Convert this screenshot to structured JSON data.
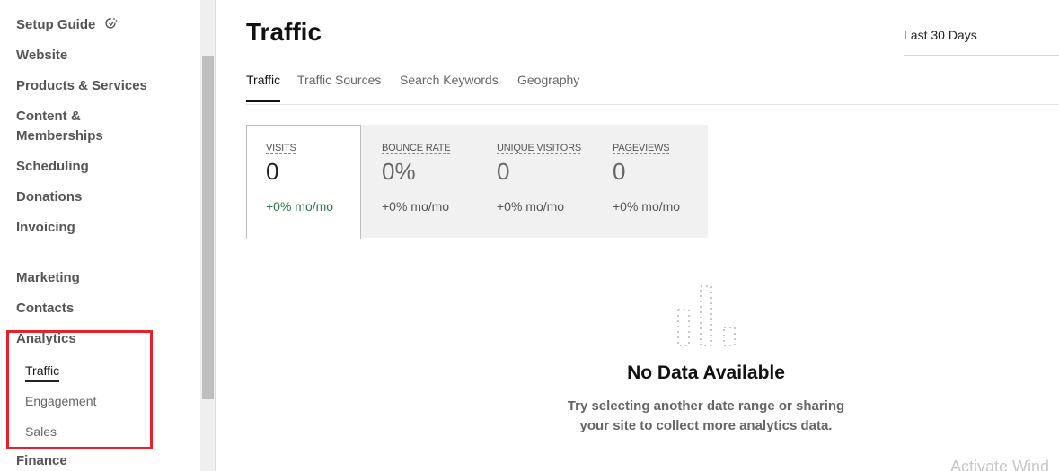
{
  "sidebar": {
    "items": [
      {
        "label": "Setup Guide",
        "icon": "setup-guide-check-icon"
      },
      {
        "label": "Website"
      },
      {
        "label": "Products & Services"
      },
      {
        "label": "Content &"
      },
      {
        "label": "Memberships"
      },
      {
        "label": "Scheduling"
      },
      {
        "label": "Donations"
      },
      {
        "label": "Invoicing"
      },
      {
        "label": "Marketing"
      },
      {
        "label": "Contacts"
      },
      {
        "label": "Analytics"
      },
      {
        "label": "Finance"
      }
    ],
    "analytics_sub": [
      {
        "label": "Traffic",
        "active": true
      },
      {
        "label": "Engagement"
      },
      {
        "label": "Sales"
      }
    ]
  },
  "header": {
    "title": "Traffic",
    "date_range": "Last 30 Days"
  },
  "tabs": [
    {
      "label": "Traffic",
      "active": true
    },
    {
      "label": "Traffic Sources"
    },
    {
      "label": "Search Keywords"
    },
    {
      "label": "Geography"
    }
  ],
  "metrics": [
    {
      "label": "VISITS",
      "value": "0",
      "change": "+0% mo/mo",
      "active": true
    },
    {
      "label": "BOUNCE RATE",
      "value": "0%",
      "change": "+0% mo/mo"
    },
    {
      "label": "UNIQUE VISITORS",
      "value": "0",
      "change": "+0% mo/mo"
    },
    {
      "label": "PAGEVIEWS",
      "value": "0",
      "change": "+0% mo/mo"
    }
  ],
  "empty_state": {
    "icon": "empty-bar-chart-icon",
    "title": "No Data Available",
    "line1": "Try selecting another date range or sharing",
    "line2": "your site to collect more analytics data."
  },
  "watermark": "Activate Wind",
  "colors": {
    "highlight": "#e8212e",
    "positive_change": "#2c7a4b"
  }
}
